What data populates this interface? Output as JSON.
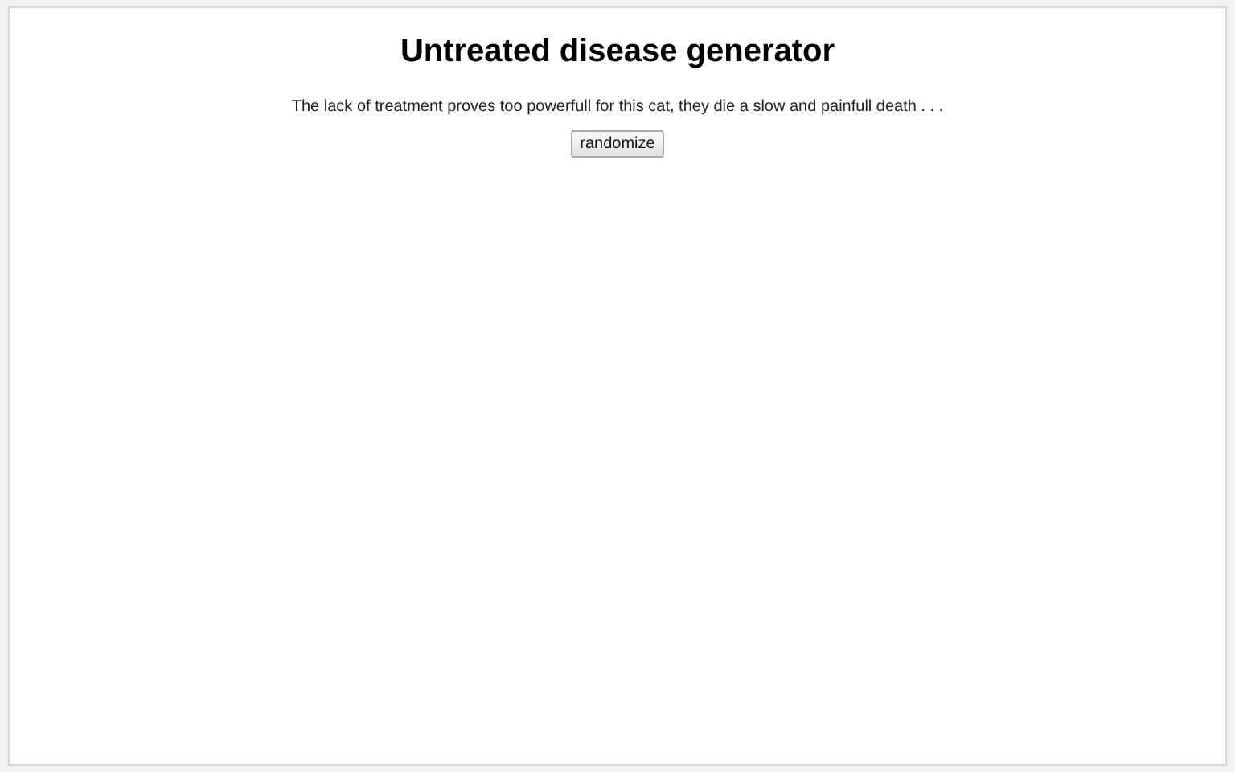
{
  "title": "Untreated disease generator",
  "result": "The lack of treatment proves too powerfull for this cat, they die a slow and painfull death . . .",
  "button": "randomize"
}
